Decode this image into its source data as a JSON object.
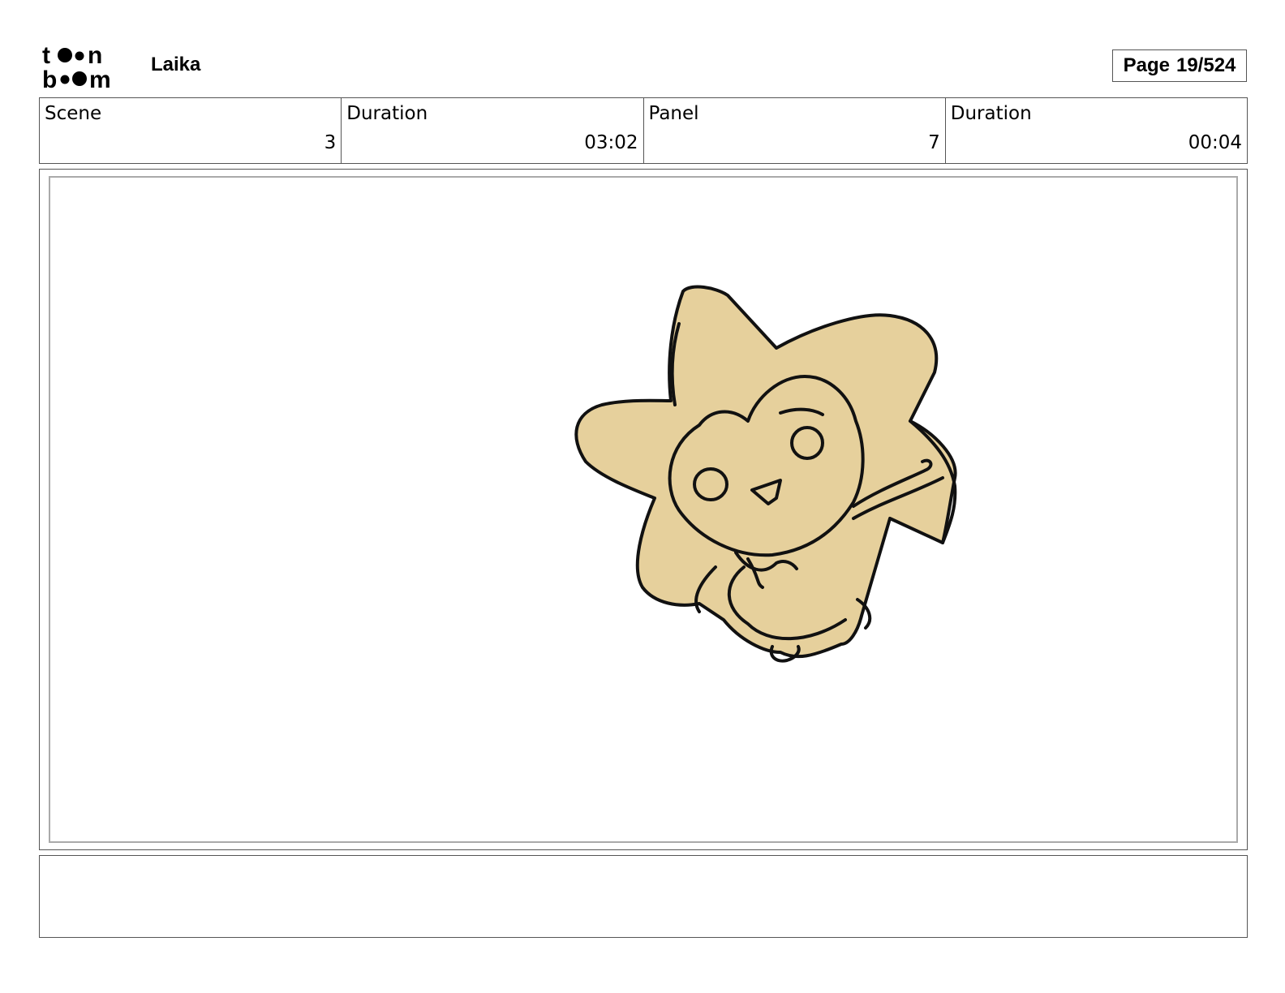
{
  "brand": {
    "logo_text_top": "toon",
    "logo_text_bottom": "boom",
    "project": "Laika"
  },
  "page": {
    "label": "Page",
    "number": "19/524"
  },
  "info": [
    {
      "label": "Scene",
      "value": "3"
    },
    {
      "label": "Duration",
      "value": "03:02"
    },
    {
      "label": "Panel",
      "value": "7"
    },
    {
      "label": "Duration",
      "value": "00:04"
    }
  ],
  "colors": {
    "character_fill": "#e6d09c",
    "line": "#111111",
    "frame_border": "#555555",
    "inner_border": "#aaaaaa"
  },
  "notes": ""
}
